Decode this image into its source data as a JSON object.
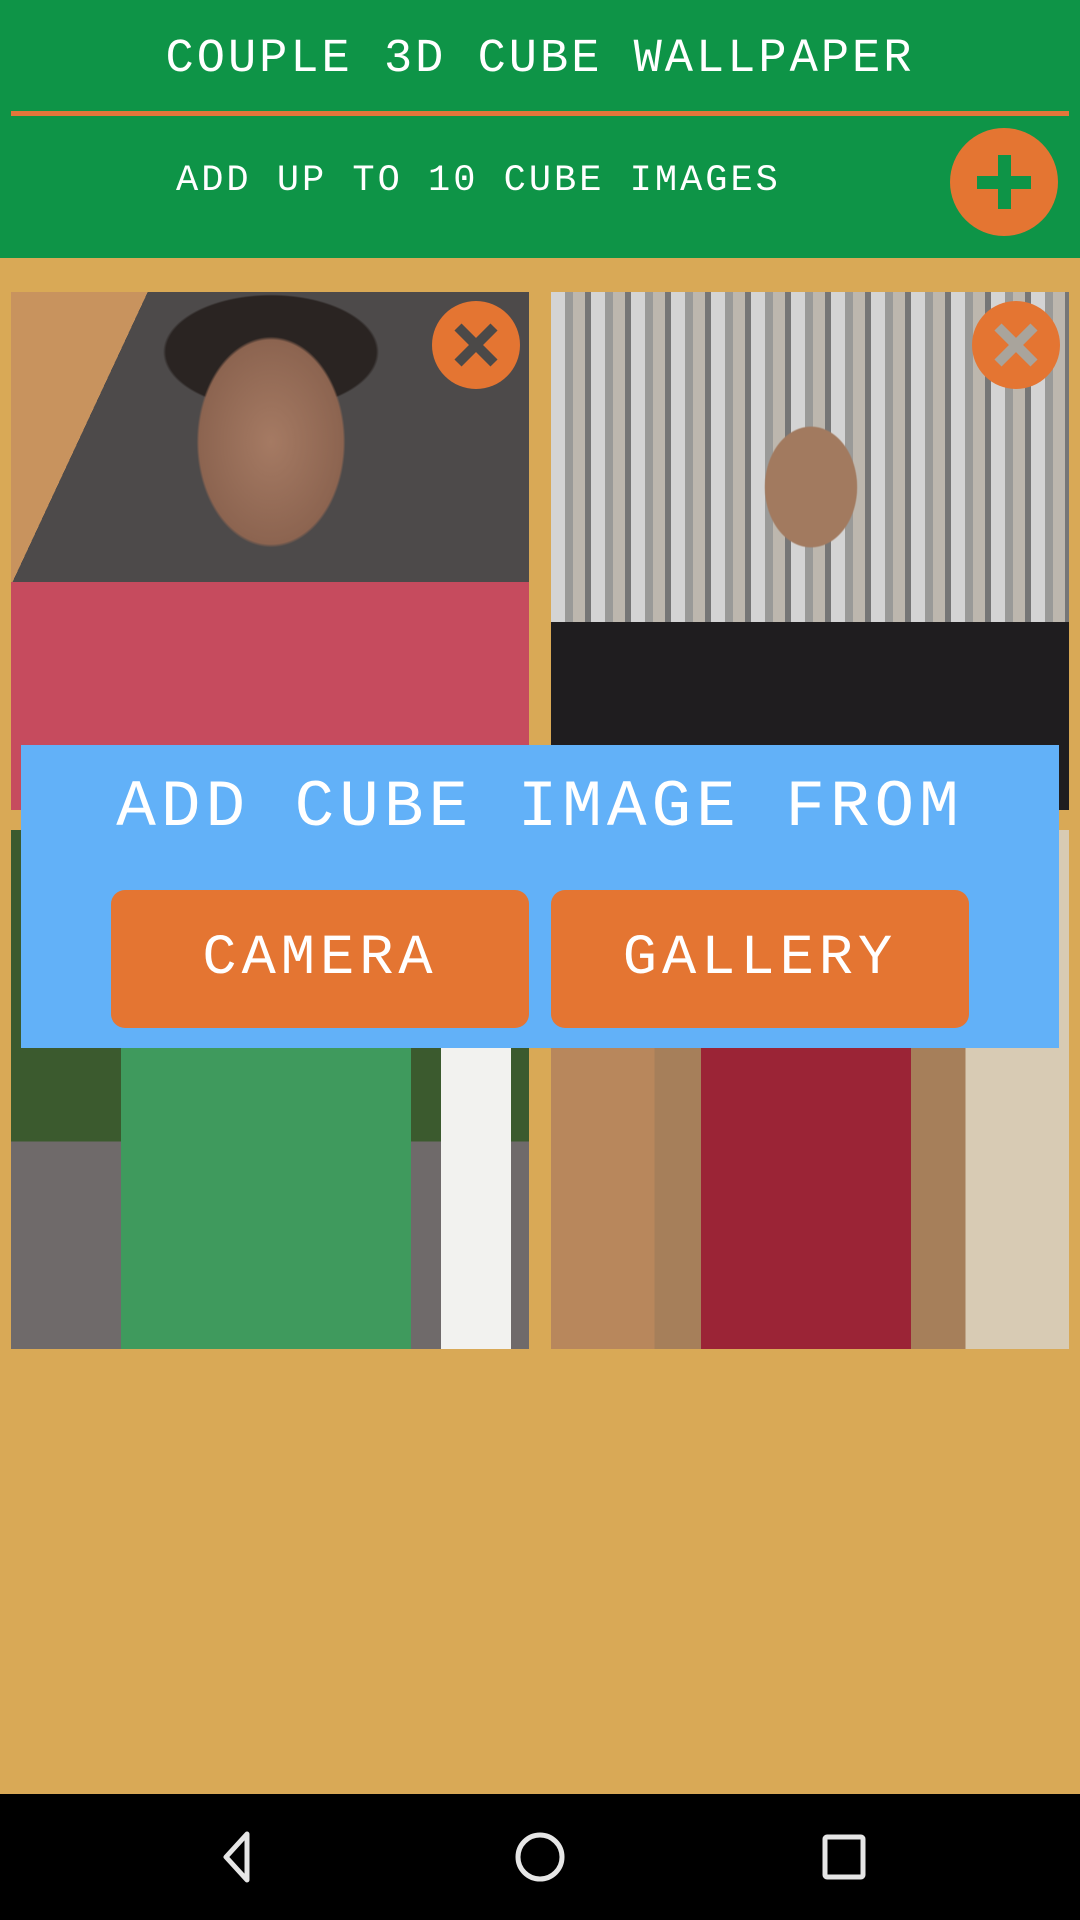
{
  "header": {
    "title": "COUPLE 3D CUBE WALLPAPER",
    "subtitle": "ADD UP TO 10 CUBE IMAGES",
    "add_icon": "plus-icon"
  },
  "tiles": [
    {
      "subject": "man in red tank top",
      "close_icon": "close-icon"
    },
    {
      "subject": "man in black shirt before waterfall wall",
      "close_icon": "close-icon"
    },
    {
      "subject": "man in green henley shirt",
      "close_icon": "close-icon"
    },
    {
      "subject": "man in maroon shirt and plaid pants",
      "close_icon": "close-icon"
    }
  ],
  "dialog": {
    "title": "ADD CUBE IMAGE FROM",
    "camera_label": "CAMERA",
    "gallery_label": "GALLERY"
  },
  "navbar": {
    "back_icon": "back-icon",
    "home_icon": "home-icon",
    "recents_icon": "recents-icon"
  },
  "colors": {
    "header_green": "#0e9447",
    "accent_orange": "#e47532",
    "background_tan": "#d9a956",
    "dialog_blue": "#62b1f8"
  }
}
